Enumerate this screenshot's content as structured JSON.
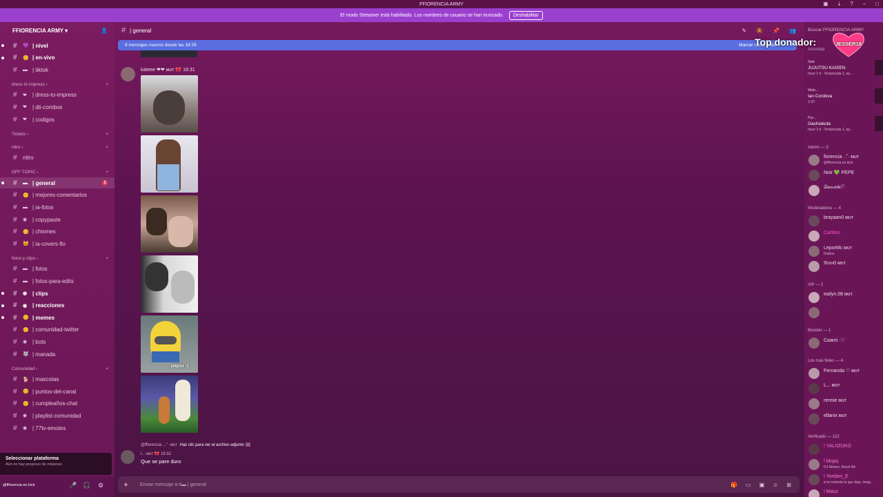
{
  "window": {
    "title": "FFIORENCIA ARMY"
  },
  "banner": {
    "text": "El modo Streamer está habilitado. Los nombres de usuario se han truncado.",
    "button": "Deshabilitar"
  },
  "server": {
    "name": "FFIORENCIA ARMY"
  },
  "channels": [
    {
      "name": "| nivel",
      "emoji": "💜",
      "bold": true
    },
    {
      "name": "| en-vivo",
      "emoji": "😊",
      "bold": true
    },
    {
      "name": "| tiktok",
      "emoji": "▬",
      "bold": false
    },
    {
      "category": "dress to impress"
    },
    {
      "name": "| dress-to-impress",
      "emoji": "❤",
      "bold": false
    },
    {
      "name": "| dti-combos",
      "emoji": "❤",
      "bold": false
    },
    {
      "name": "| codigos",
      "emoji": "❤",
      "bold": false
    },
    {
      "category": "Tickets"
    },
    {
      "category": "nitro"
    },
    {
      "name": "nitro",
      "emoji": "",
      "bold": false
    },
    {
      "category": "OFF TOPIC"
    },
    {
      "name": "| general",
      "emoji": "▬",
      "bold": true,
      "selected": true,
      "badge": "1"
    },
    {
      "name": "| mejores-comentarios",
      "emoji": "😊",
      "bold": false
    },
    {
      "name": "| ia-fotos",
      "emoji": "▬",
      "bold": false
    },
    {
      "name": "| copypaste",
      "emoji": "◉",
      "bold": false
    },
    {
      "name": "| chismes",
      "emoji": "😊",
      "bold": false
    },
    {
      "name": "| ia-covers-flo",
      "emoji": "😺",
      "bold": false
    },
    {
      "category": "fotos y clips"
    },
    {
      "name": "| fotos",
      "emoji": "▬",
      "bold": false
    },
    {
      "name": "| fotos-para-edits",
      "emoji": "▬",
      "bold": false
    },
    {
      "name": "| clips",
      "emoji": "◉",
      "bold": true
    },
    {
      "name": "| reacciones",
      "emoji": "◉",
      "bold": true
    },
    {
      "name": "| memes",
      "emoji": "😊",
      "bold": true
    },
    {
      "name": "| comunidad-twitter",
      "emoji": "😊",
      "bold": false
    },
    {
      "name": "| bots",
      "emoji": "◉",
      "bold": false
    },
    {
      "name": "| manada",
      "emoji": "🐺",
      "bold": false
    },
    {
      "category": "Comunidad"
    },
    {
      "name": "| mascotas",
      "emoji": "🐕",
      "bold": false
    },
    {
      "name": "| puntos-del-canal",
      "emoji": "😊",
      "bold": false
    },
    {
      "name": "| cumpleaños-chat",
      "emoji": "😊",
      "bold": false
    },
    {
      "name": "| playlist-comunidad",
      "emoji": "◉",
      "bold": false
    },
    {
      "name": "| 77tv-emotes",
      "emoji": "◉",
      "bold": false
    }
  ],
  "mission": {
    "title": "Seleccionar plataforma",
    "subtitle": "Aún no hay progreso de misiones"
  },
  "user": {
    "name": "@fflorencia en kick"
  },
  "channel_header": {
    "name": "| general"
  },
  "new_messages": {
    "text": "9 mensajes nuevos desde las 18:29",
    "mark": "Marcar como leído"
  },
  "message1": {
    "user": "kateee ❤❤ ᴍᴜᴛ 🎀 18:31",
    "gif_caption": "papoi :("
  },
  "reply": {
    "text": "@fflorencia ..·˚· ᴍᴜᴛ",
    "link": "Haz clic para ver el archivo adjunto"
  },
  "message2": {
    "user": "l... ᴍᴜᴛ 🎀 18:32",
    "text": "Que se pare duro"
  },
  "input": {
    "placeholder": "Enviar mensaje a #▬ | general"
  },
  "members": {
    "search": "Buscar FFIORENCIA ARMY",
    "top_donor": "Top donador:",
    "top_donor_name": "JESSER18",
    "activity_label": "Actividad",
    "activity": [
      {
        "a1": "Noir",
        "a2": "JUJUTSU KAISEN",
        "a3": "hace 1 d · Temporada 1, ep..."
      },
      {
        "a1": "Web...",
        "a2": "Ian Cordova",
        "a3": "1:20"
      },
      {
        "a1": "Pyr...",
        "a2": "Gachiakuta",
        "a3": "hace 3 d · Temporada 1, ep..."
      }
    ],
    "groups": [
      {
        "label": "Admin — 3",
        "members": [
          {
            "name": "fiorencia .·˚· ᴍᴜᴛ",
            "sub": "@fflorencia en kick"
          },
          {
            "name": "Noir 💚 PEPE"
          },
          {
            "name": "𝒟𝒶𝓃𝒾𝑒𝓁𝒶♡"
          }
        ]
      },
      {
        "label": "Moderadores — 4",
        "members": [
          {
            "name": "brayaan0 ᴍᴜᴛ"
          },
          {
            "name": "Carlitos"
          },
          {
            "name": "LeporMc ᴍᴜᴛ",
            "sub": "Roblox"
          },
          {
            "name": "𝔅𝔯𝔞𝔫0 ᴍᴜᴛ"
          }
        ]
      },
      {
        "label": "VIP — 2",
        "members": [
          {
            "name": "eailyn.08 ᴍᴜᴛ"
          },
          {
            "name": "·"
          }
        ]
      },
      {
        "label": "Booster — 1",
        "members": [
          {
            "name": "Caami ·♡"
          }
        ]
      },
      {
        "label": "Los mas fieles — 4",
        "members": [
          {
            "name": "Fernanda ♡ ᴍᴜᴛ"
          },
          {
            "name": "L... ᴍᴜᴛ"
          },
          {
            "name": "rennie ᴍᴜᴛ"
          },
          {
            "name": "ellanix ᴍᴜᴛ"
          }
        ]
      },
      {
        "label": "Verificado — 122",
        "members": [
          {
            "name": "! YALIIZUKO"
          },
          {
            "name": "! blopq",
            "sub": "DJ Nelson, Anuel AA"
          },
          {
            "name": "! Yordani_E",
            "sub": "si te molesta lo que digo, imag..."
          },
          {
            "name": "! Mauz"
          }
        ]
      }
    ]
  },
  "colors": {
    "accent": "#9b3fcf",
    "new_bar": "#5a6ee0",
    "badge": "#e03a5a"
  }
}
